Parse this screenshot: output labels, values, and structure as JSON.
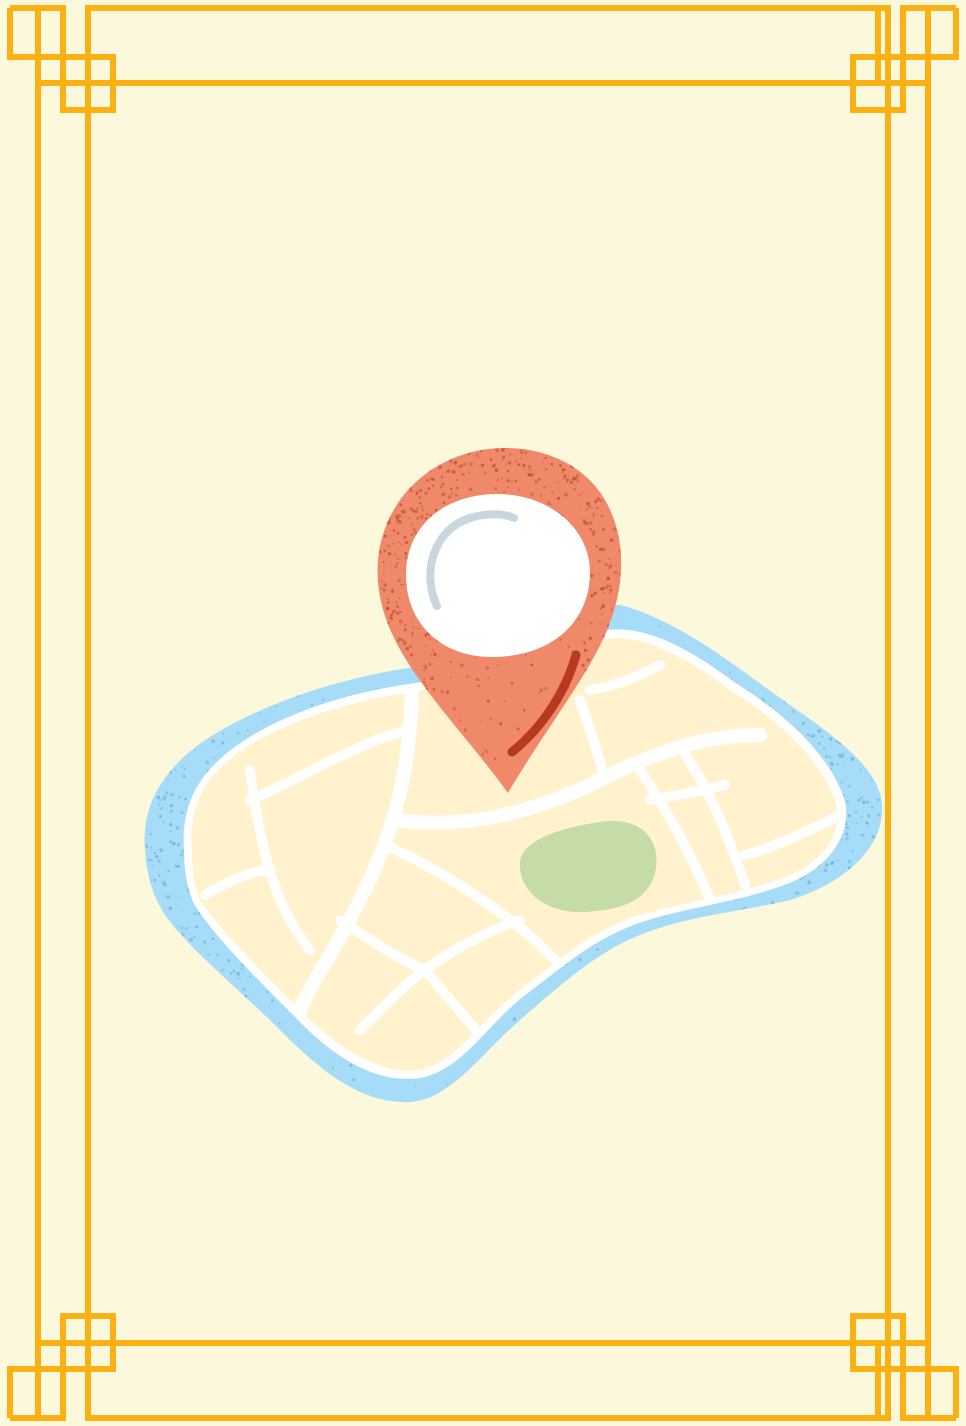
{
  "scene": {
    "subject": "map-with-location-pin",
    "icons": [
      "frame-border",
      "map-illustration",
      "location-pin-icon",
      "park-area"
    ]
  },
  "colors": {
    "background": "#fcf8dc",
    "frame": "#fbb114",
    "water": "#a6dcf8",
    "water_speckle": "#7ab8dc",
    "land": "#fff2cc",
    "roads": "#ffffff",
    "park": "#c6dca6",
    "pin": "#f0896a",
    "pin_speckle": "#c8583c",
    "pin_highlight": "#c8d6e0",
    "pin_accent": "#b73a1f"
  }
}
